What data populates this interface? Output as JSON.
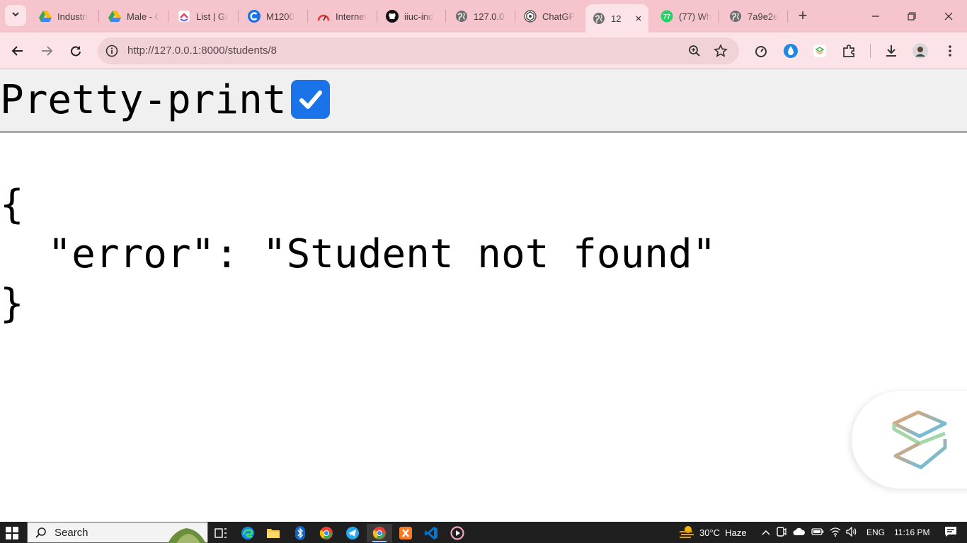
{
  "browser": {
    "tabs": [
      {
        "title": "Industri",
        "icon": "google-drive-icon"
      },
      {
        "title": "Male - C",
        "icon": "google-drive-icon"
      },
      {
        "title": "List | Gr",
        "icon": "clickup-icon"
      },
      {
        "title": "M1200",
        "icon": "c-logo-icon"
      },
      {
        "title": "Internet",
        "icon": "speed-gauge-icon"
      },
      {
        "title": "iiuc-ind",
        "icon": "github-icon"
      },
      {
        "title": "127.0.0.",
        "icon": "globe-icon"
      },
      {
        "title": "ChatGP",
        "icon": "chatgpt-icon"
      },
      {
        "title": "12",
        "icon": "globe-icon",
        "active": true
      },
      {
        "title": "(77) Wh",
        "icon": "whatsapp-icon",
        "badge": "77"
      },
      {
        "title": "7a9e2e",
        "icon": "globe-icon"
      }
    ],
    "new_tab": "+",
    "close_tab": "×",
    "url": "http://127.0.0.1:8000/students/8"
  },
  "page": {
    "pretty_print_label": "Pretty-print",
    "pretty_print_checked": true,
    "json_lines": [
      "{",
      "  \"error\": \"Student not found\"",
      "}"
    ]
  },
  "taskbar": {
    "search_placeholder": "Search",
    "weather": "30°C  Haze",
    "language": "ENG",
    "time": "11:16 PM"
  },
  "colors": {
    "tab_strip": "#f6c4cc",
    "toolbar": "#fbe3e7",
    "checkbox": "#1a73e8",
    "taskbar": "#1f1f1f"
  }
}
